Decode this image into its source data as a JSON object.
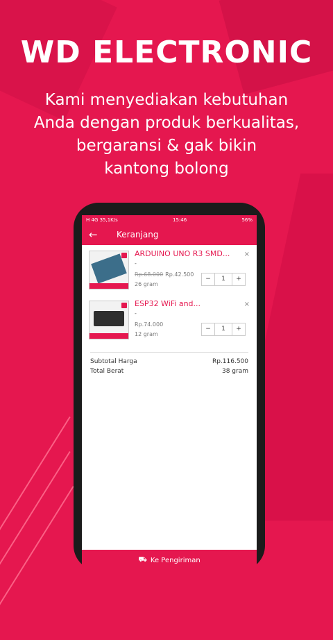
{
  "promo": {
    "headline": "WD ELECTRONIC",
    "subtext_lines": [
      "Kami menyediakan kebutuhan",
      "Anda dengan produk berkualitas,",
      "bergaransi & gak bikin",
      "kantong bolong"
    ]
  },
  "statusbar": {
    "left": "H 4G 35,1K/s",
    "time": "15:46",
    "battery": "56%"
  },
  "appbar": {
    "title": "Keranjang",
    "back_icon": "arrow-left-icon"
  },
  "cart": {
    "items": [
      {
        "name": "ARDUINO UNO R3 SMD...",
        "variant": "-",
        "old_price": "Rp.68.000",
        "price": "Rp.42.500",
        "weight": "26 gram",
        "quantity": "1"
      },
      {
        "name": "ESP32 WiFi and...",
        "variant": "-",
        "old_price": "",
        "price": "Rp.74.000",
        "weight": "12 gram",
        "quantity": "1"
      }
    ],
    "stepper": {
      "minus": "−",
      "plus": "+"
    },
    "remove_icon": "×"
  },
  "summary": {
    "subtotal_label": "Subtotal Harga",
    "subtotal_value": "Rp.116.500",
    "weight_label": "Total Berat",
    "weight_value": "38 gram"
  },
  "checkout": {
    "label": "Ke Pengiriman",
    "icon": "truck-icon"
  },
  "colors": {
    "brand": "#e5174f"
  }
}
